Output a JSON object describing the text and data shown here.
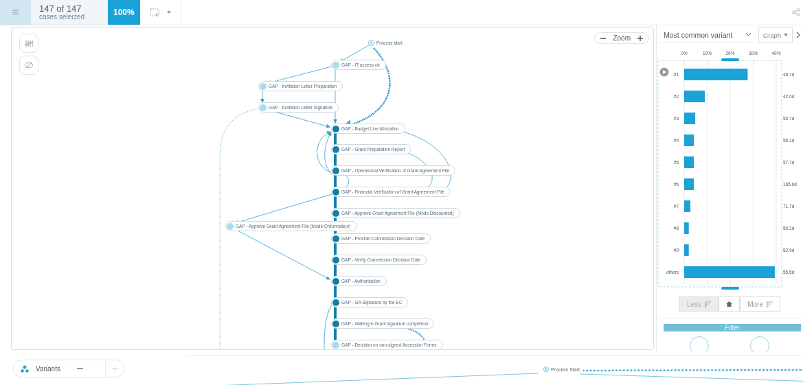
{
  "topbar": {
    "case_count": "147 of 147",
    "case_caption": "cases selected",
    "percentage": "100%"
  },
  "canvas": {
    "zoom_label": "Zoom",
    "nodes": [
      {
        "label": "Process start",
        "kind": "start"
      },
      {
        "label": "GAP - IT access ok",
        "kind": "rare"
      },
      {
        "label": "GAP - Invitation Letter Preparation",
        "kind": "rare"
      },
      {
        "label": "GAP - Invitation Letter Signature",
        "kind": "rare"
      },
      {
        "label": "GAP - Budget Line Allocation",
        "kind": "frequent"
      },
      {
        "label": "GAP - Grant Preparation Report",
        "kind": "frequent"
      },
      {
        "label": "GAP - Operational Verification of Grant Agreement File",
        "kind": "frequent"
      },
      {
        "label": "GAP - Financial Verification of Grant Agreement File",
        "kind": "frequent"
      },
      {
        "label": "GAP - Approve Grant Agreement File (Mode Discounted)",
        "kind": "frequent"
      },
      {
        "label": "GAP - Approve Grant Agreement File (Mode Ordonnateur)",
        "kind": "rare"
      },
      {
        "label": "GAP - Provide Commission Decision Date",
        "kind": "frequent"
      },
      {
        "label": "GAP - Verify Commission Decision Date",
        "kind": "frequent"
      },
      {
        "label": "GAP - Authorisation",
        "kind": "frequent"
      },
      {
        "label": "GAP - GA Signature by the EC",
        "kind": "frequent"
      },
      {
        "label": "GAP - Waiting e-Grant signature completion",
        "kind": "frequent"
      },
      {
        "label": "GAP - Decision on non-signed Accession Forms",
        "kind": "rare"
      }
    ]
  },
  "variant_panel": {
    "variant_select": "Most common variant",
    "view_button": "Graph",
    "chart_data": {
      "type": "bar",
      "orientation": "horizontal",
      "categories": [
        "#1",
        "#2",
        "#3",
        "#4",
        "#5",
        "#6",
        "#7",
        "#8",
        "#9",
        "others"
      ],
      "values": [
        27.6,
        9,
        4.8,
        4.2,
        4.2,
        4.2,
        2.7,
        2,
        2,
        39.4
      ],
      "xlim": [
        0,
        43
      ],
      "grid": true,
      "xticks": [
        {
          "value": 0,
          "label": "0%"
        },
        {
          "value": 10,
          "label": "10%"
        },
        {
          "value": 20,
          "label": "20%"
        },
        {
          "value": 30,
          "label": "30%"
        },
        {
          "value": 40,
          "label": "40%"
        }
      ]
    },
    "durations": [
      "48.7d",
      "42.0d",
      "55.7d",
      "56.1d",
      "57.7d",
      "165.9d",
      "71.7d",
      "59.2d",
      "82.9d",
      "55.5d"
    ],
    "buttons": [
      {
        "label": "Less",
        "kind": "less",
        "disabled": true
      },
      {
        "kind": "home",
        "disabled": false
      },
      {
        "label": "More",
        "kind": "more",
        "disabled": false
      }
    ],
    "filter_button": "Filter"
  },
  "variants_bar": {
    "label": "Variants"
  },
  "lower_graph": {
    "start_node": "Process Start"
  }
}
